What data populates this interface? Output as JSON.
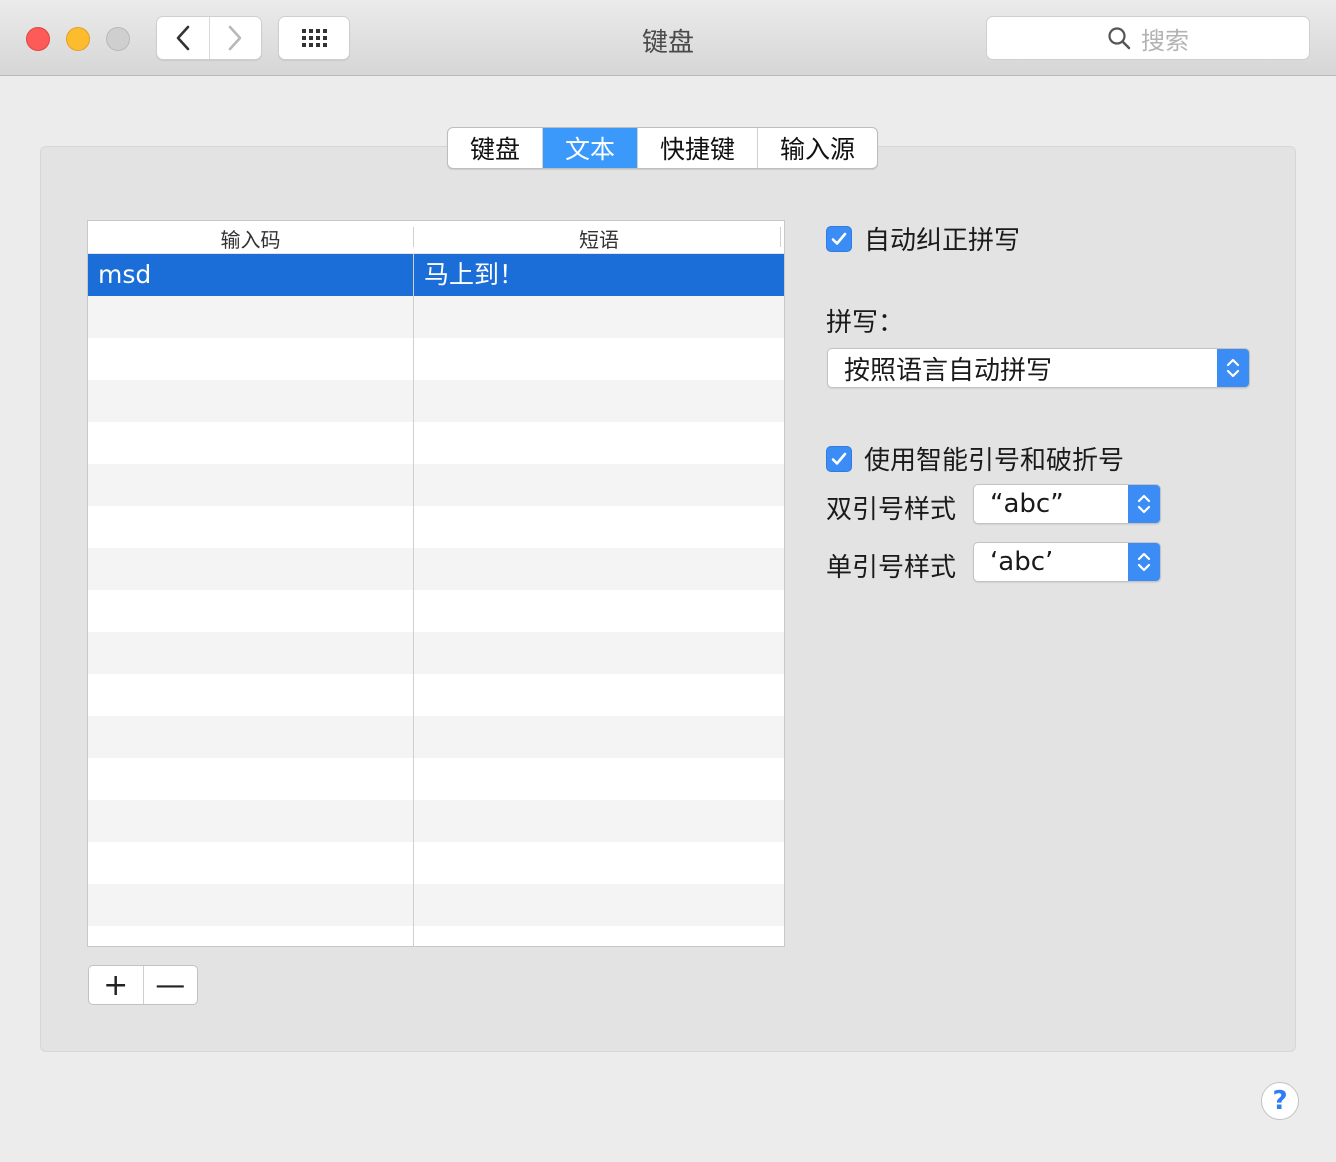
{
  "window": {
    "title": "键盘"
  },
  "search": {
    "placeholder": "搜索",
    "icon": "search-icon"
  },
  "tabs": [
    {
      "label": "键盘",
      "active": false
    },
    {
      "label": "文本",
      "active": true
    },
    {
      "label": "快捷键",
      "active": false
    },
    {
      "label": "输入源",
      "active": false
    }
  ],
  "table": {
    "headers": [
      "输入码",
      "短语"
    ],
    "rows": [
      {
        "input": "msd",
        "phrase": "马上到！",
        "selected": true
      }
    ]
  },
  "buttons": {
    "add": "+",
    "remove": "—",
    "help": "?"
  },
  "options": {
    "autocorrect_label": "自动纠正拼写",
    "autocorrect_checked": true,
    "spelling_label": "拼写：",
    "spelling_value": "按照语言自动拼写",
    "smart_quotes_label": "使用智能引号和破折号",
    "smart_quotes_checked": true,
    "double_quote_label": "双引号样式",
    "double_quote_value": "“abc”",
    "single_quote_label": "单引号样式",
    "single_quote_value": "‘abc’"
  },
  "colors": {
    "accent": "#3b99fc",
    "selection": "#1b6ed8",
    "close": "#fc5b57",
    "minimize": "#fdbc2e"
  }
}
